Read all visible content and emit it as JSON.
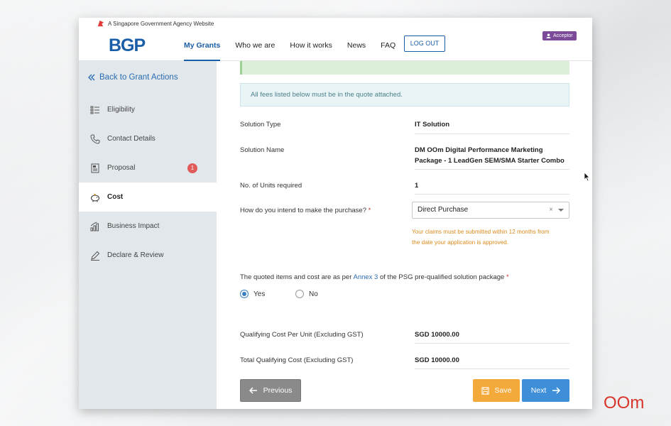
{
  "gov_bar": {
    "text": "A Singapore Government Agency Website"
  },
  "header": {
    "logo": "BGP",
    "nav": [
      "My Grants",
      "Who we are",
      "How it works",
      "News",
      "FAQ"
    ],
    "logout": "LOG OUT",
    "role": "Acceptor"
  },
  "sidebar": {
    "back": "Back to Grant Actions",
    "items": [
      {
        "label": "Eligibility",
        "icon": "list-icon"
      },
      {
        "label": "Contact Details",
        "icon": "phone-icon"
      },
      {
        "label": "Proposal",
        "icon": "document-icon",
        "badge": "1"
      },
      {
        "label": "Cost",
        "icon": "piggy-bank-icon",
        "active": true
      },
      {
        "label": "Business Impact",
        "icon": "bar-chart-icon"
      },
      {
        "label": "Declare & Review",
        "icon": "pen-icon"
      }
    ]
  },
  "main": {
    "info": "All fees listed below must be in the quote attached.",
    "fields": [
      {
        "label": "Solution Type",
        "value": "IT Solution"
      },
      {
        "label": "Solution Name",
        "value_line1": "DM OOm Digital Performance Marketing",
        "value_line2": "Package  - 1 LeadGen SEM/SMA Starter Combo"
      },
      {
        "label": "No. of Units required",
        "value": "1"
      }
    ],
    "purchase": {
      "label": "How do you intend to make the purchase?",
      "required": "*",
      "selected": "Direct Purchase",
      "clear": "×",
      "warning_line1": "Your claims must be submitted within 12 months from",
      "warning_line2": "the date your application is approved."
    },
    "quote": {
      "text_before": "The quoted items and cost are as per ",
      "link": "Annex 3",
      "text_after": " of the PSG pre-qualified solution package ",
      "required": "*",
      "options": [
        "Yes",
        "No"
      ],
      "selected": "Yes"
    },
    "costs": [
      {
        "label": "Qualifying Cost Per Unit (Excluding GST)",
        "value": "SGD 10000.00"
      },
      {
        "label": "Total Qualifying Cost (Excluding GST)",
        "value": "SGD 10000.00"
      }
    ],
    "buttons": {
      "previous": "Previous",
      "save": "Save",
      "next": "Next"
    }
  },
  "watermark": {
    "brand": "OOm"
  },
  "colors": {
    "primary": "#1a5ea8",
    "save": "#f4a93b",
    "next": "#3f8fd8",
    "badge": "#e05a5a",
    "role": "#7b4a99"
  }
}
